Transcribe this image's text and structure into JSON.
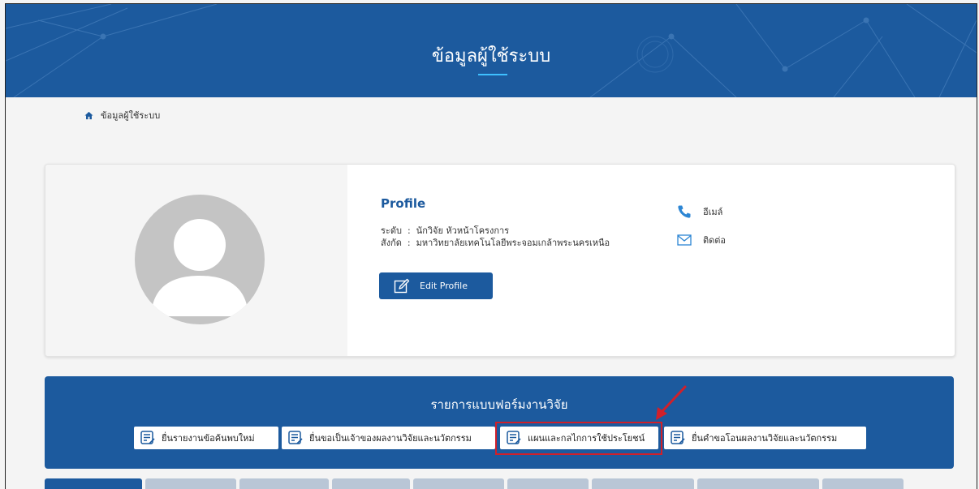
{
  "banner": {
    "title": "ข้อมูลผู้ใช้ระบบ"
  },
  "breadcrumb": {
    "current": "ข้อมูลผู้ใช้ระบบ"
  },
  "profile": {
    "heading": "Profile",
    "level_label": "ระดับ",
    "level_value": "นักวิจัย หัวหน้าโครงการ",
    "affiliation_label": "สังกัด",
    "affiliation_value": "มหาวิทยาลัยเทคโนโลยีพระจอมเกล้าพระนครเหนือ",
    "separator": ":",
    "edit_button": "Edit Profile",
    "email_label": "อีเมล์",
    "contact_label": "ติดต่อ"
  },
  "forms": {
    "title": "รายการแบบฟอร์มงานวิจัย",
    "buttons": [
      {
        "label": "ยื่นรายงานข้อค้นพบใหม่"
      },
      {
        "label": "ยื่นขอเป็นเจ้าของผลงานวิจัยและนวัตกรรม"
      },
      {
        "label": "แผนและกลไกการใช้ประโยชน์"
      },
      {
        "label": "ยื่นคำขอโอนผลงานวิจัยและนวัตกรรม"
      }
    ]
  },
  "colors": {
    "primary": "#1c5a9e",
    "accent": "#3ec0ff",
    "highlight": "#d0202a"
  },
  "icons": {
    "home": "home-icon",
    "phone": "phone-icon",
    "mail": "mail-icon",
    "edit": "edit-icon",
    "document": "document-icon"
  }
}
